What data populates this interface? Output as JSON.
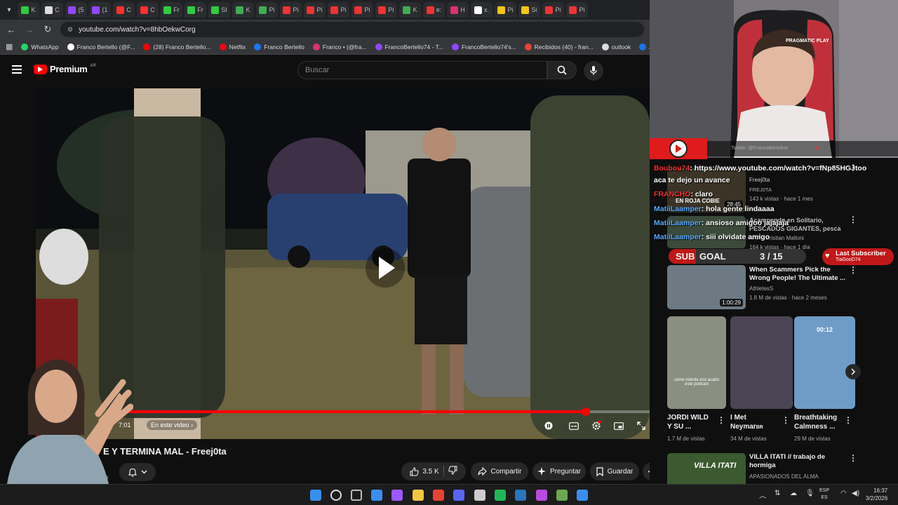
{
  "browser": {
    "tab_labels": [
      "K",
      "C",
      "(5",
      "(1",
      "C",
      "C",
      "Fr",
      "Fr",
      "SI",
      "K",
      "Pi",
      "Pi",
      "Pi",
      "Pi",
      "Pi",
      "Pi",
      "K",
      "e:",
      "H",
      "x.",
      "Pi",
      "Si",
      "Pi",
      "Pi"
    ],
    "url": "youtube.com/watch?v=8hbOekwCorg",
    "bookmarks": [
      "WhatsApp",
      "Franco Bertello (@F...",
      "(28) Franco Bertello...",
      "Netflix",
      "Franco Bertello",
      "Franco •  (@fra...",
      "FrancoBertello74 - T...",
      "FrancoBertello74's...",
      "Recibidos (40) - fran...",
      "outlook",
      "Aler"
    ]
  },
  "youtube": {
    "logo_text": "Premium",
    "logo_region": "AR",
    "search_placeholder": "Buscar"
  },
  "player": {
    "progress_fraction": 0.88,
    "time_fragment": "7:01",
    "chapter_label": "En este video",
    "chapter_chevron": "›"
  },
  "video": {
    "title_fragment": "E Y TERMINA MAL - Freej0ta",
    "subs_fragment": "otores",
    "like_count": "3.5 K",
    "share_label": "Compartir",
    "ask_label": "Preguntar",
    "save_label": "Guardar"
  },
  "sidebar": {
    "rec1": {
      "channel": "Freej0ta",
      "channel_small": "FREJ0TA",
      "meta": "143 k vistas · hace 1 mes",
      "duration": "28:45",
      "thumb_text": "EN ROJA COBIE"
    },
    "rec2": {
      "title": "Acampando en Solitario, PESCADOS GIGANTES, pesca ...",
      "channel": "ANA - Cristian Malloni",
      "meta": "164 k vistas · hace 1 día"
    },
    "rec3": {
      "title": "When Scammers Pick the Wrong People! The Ultimate ...",
      "channel": "AthletesS",
      "meta": "1.8 M de vistas · hace 2 meses",
      "duration": "1:00:29"
    },
    "shorts": [
      {
        "title": "JORDI WILD Y SU ...",
        "views": "1.7 M de vistas",
        "thumb_text": "cómo mierda eso acabo este podcast"
      },
      {
        "title": "I Met Neymar",
        "badge": "BR",
        "views": "34 M de vistas"
      },
      {
        "title": "Breathtaking Calmness ...",
        "views": "29 M de vistas",
        "duration": "00:12"
      }
    ],
    "rec4": {
      "title": "VILLA ITATI // trabajo de hormiga",
      "channel": "APASIONADOS DEL ALMA",
      "thumb_text": "VILLA ITATI"
    }
  },
  "stream_overlay": {
    "twitter_handle": "Twitter: @FrancoBertello4",
    "sub_goal_prefix": "SUB",
    "sub_goal_label": "GOAL",
    "sub_goal_progress": "3 / 15",
    "last_sub_label": "Last Subscriber",
    "last_sub_name": "TiaGooD74",
    "webcam_chair_brand": "PRAGMATIC PLAY",
    "chat": [
      {
        "user": "Boubou74",
        "message": ": https://www.youtube.com/watch?v=fNp85HGJtoo"
      },
      {
        "user": "",
        "message": "aca te dejo un avance"
      },
      {
        "user": "FRANCHO",
        "message": ": claro"
      },
      {
        "user": "MatiiLaamper",
        "message": ": hola gente lindaaaa"
      },
      {
        "user": "MatiiLaamper",
        "message": ": ansioso amigoo jajajaja"
      },
      {
        "user": "MatiiLaamper",
        "message": ": siii olvidate amigo"
      }
    ]
  },
  "taskbar": {
    "lang_top": "ESP",
    "lang_bottom": "ES",
    "time": "16:37",
    "date": "3/2/2026"
  },
  "colors": {
    "youtube_red": "#ff0000",
    "accent_blue": "#5aa9ff"
  }
}
